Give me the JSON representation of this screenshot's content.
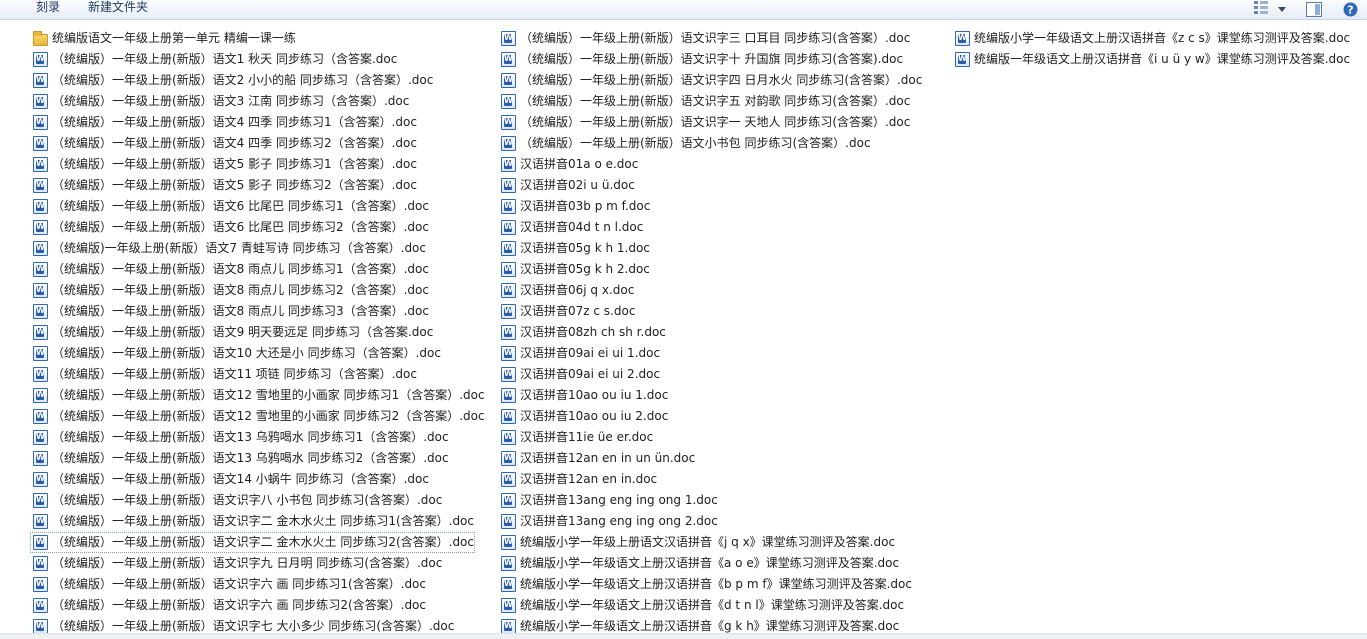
{
  "toolbar": {
    "burn_label": "刻录",
    "new_folder_label": "新建文件夹",
    "view_icon": "view-options-icon",
    "pane_icon": "preview-pane-icon",
    "help_icon": "help-icon"
  },
  "files": {
    "column1": [
      {
        "name": "统编版语文一年级上册第一单元 精编一课一练",
        "type": "folder"
      },
      {
        "name": "（统编版）一年级上册(新版）语文1 秋天 同步练习（含答案.doc",
        "type": "doc"
      },
      {
        "name": "（统编版）一年级上册(新版）语文2 小小的船 同步练习（含答案）.doc",
        "type": "doc"
      },
      {
        "name": "（统编版）一年级上册(新版）语文3 江南 同步练习（含答案）.doc",
        "type": "doc"
      },
      {
        "name": "（统编版）一年级上册(新版）语文4 四季 同步练习1（含答案）.doc",
        "type": "doc"
      },
      {
        "name": "（统编版）一年级上册(新版）语文4 四季 同步练习2（含答案）.doc",
        "type": "doc"
      },
      {
        "name": "（统编版）一年级上册(新版）语文5 影子 同步练习1（含答案）.doc",
        "type": "doc"
      },
      {
        "name": "（统编版）一年级上册(新版）语文5 影子 同步练习2（含答案）.doc",
        "type": "doc"
      },
      {
        "name": "（统编版）一年级上册(新版）语文6 比尾巴 同步练习1（含答案）.doc",
        "type": "doc"
      },
      {
        "name": "（统编版）一年级上册(新版）语文6 比尾巴 同步练习2（含答案）.doc",
        "type": "doc"
      },
      {
        "name": "（统编版)一年级上册(新版）语文7 青蛙写诗 同步练习（含答案）.doc",
        "type": "doc"
      },
      {
        "name": "（统编版）一年级上册(新版）语文8 雨点儿 同步练习1（含答案）.doc",
        "type": "doc"
      },
      {
        "name": "（统编版）一年级上册(新版）语文8 雨点儿 同步练习2（含答案）.doc",
        "type": "doc"
      },
      {
        "name": "（统编版）一年级上册(新版）语文8 雨点儿 同步练习3（含答案）.doc",
        "type": "doc"
      },
      {
        "name": "（统编版）一年级上册(新版）语文9 明天要远足 同步练习（含答案.doc",
        "type": "doc"
      },
      {
        "name": "（统编版）一年级上册(新版）语文10  大还是小 同步练习（含答案）.doc",
        "type": "doc"
      },
      {
        "name": "（统编版）一年级上册(新版）语文11 项链 同步练习（含答案）.doc",
        "type": "doc"
      },
      {
        "name": "（统编版）一年级上册(新版）语文12 雪地里的小画家 同步练习1（含答案）.doc",
        "type": "doc"
      },
      {
        "name": "（统编版）一年级上册(新版）语文12 雪地里的小画家 同步练习2（含答案）.doc",
        "type": "doc"
      },
      {
        "name": "（统编版）一年级上册(新版）语文13 乌鸦喝水 同步练习1（含答案）.doc",
        "type": "doc"
      },
      {
        "name": "（统编版）一年级上册(新版）语文13 乌鸦喝水 同步练习2（含答案）.doc",
        "type": "doc"
      },
      {
        "name": "（统编版）一年级上册(新版）语文14 小蜗牛 同步练习（含答案）.doc",
        "type": "doc"
      },
      {
        "name": "（统编版）一年级上册(新版）语文识字八 小书包 同步练习(含答案）.doc",
        "type": "doc"
      },
      {
        "name": "（统编版）一年级上册(新版）语文识字二 金木水火土 同步练习1(含答案）.doc",
        "type": "doc"
      },
      {
        "name": "（统编版）一年级上册(新版）语文识字二 金木水火土 同步练习2(含答案）.doc",
        "type": "doc"
      },
      {
        "name": "（统编版）一年级上册(新版）语文识字九 日月明 同步练习(含答案）.doc",
        "type": "doc"
      },
      {
        "name": "（统编版）一年级上册(新版）语文识字六 画 同步练习1(含答案）.doc",
        "type": "doc"
      },
      {
        "name": "（统编版）一年级上册(新版）语文识字六 画 同步练习2(含答案）.doc",
        "type": "doc"
      },
      {
        "name": "（统编版）一年级上册(新版）语文识字七 大小多少 同步练习(含答案）.doc",
        "type": "doc"
      }
    ],
    "column2": [
      {
        "name": "（统编版）一年级上册(新版）语文识字三 口耳目 同步练习(含答案）.doc",
        "type": "doc"
      },
      {
        "name": "（统编版）一年级上册(新版）语文识字十 升国旗  同步练习(含答案).doc",
        "type": "doc"
      },
      {
        "name": "（统编版）一年级上册(新版）语文识字四 日月水火 同步练习(含答案）.doc",
        "type": "doc"
      },
      {
        "name": "（统编版）一年级上册(新版）语文识字五 对韵歌 同步练习(含答案）.doc",
        "type": "doc"
      },
      {
        "name": "（统编版）一年级上册(新版）语文识字一 天地人 同步练习(含答案）.doc",
        "type": "doc"
      },
      {
        "name": "（统编版）一年级上册(新版）语文小书包 同步练习(含答案）.doc",
        "type": "doc"
      },
      {
        "name": "汉语拼音01a o e.doc",
        "type": "doc"
      },
      {
        "name": "汉语拼音02i u ü.doc",
        "type": "doc"
      },
      {
        "name": "汉语拼音03b p m f.doc",
        "type": "doc"
      },
      {
        "name": "汉语拼音04d t n l.doc",
        "type": "doc"
      },
      {
        "name": "汉语拼音05g k h  1.doc",
        "type": "doc"
      },
      {
        "name": "汉语拼音05g k h  2.doc",
        "type": "doc"
      },
      {
        "name": "汉语拼音06j q x.doc",
        "type": "doc"
      },
      {
        "name": "汉语拼音07z c s.doc",
        "type": "doc"
      },
      {
        "name": "汉语拼音08zh ch sh r.doc",
        "type": "doc"
      },
      {
        "name": "汉语拼音09ai ei ui  1.doc",
        "type": "doc"
      },
      {
        "name": "汉语拼音09ai ei ui  2.doc",
        "type": "doc"
      },
      {
        "name": "汉语拼音10ao ou iu  1.doc",
        "type": "doc"
      },
      {
        "name": "汉语拼音10ao ou iu  2.doc",
        "type": "doc"
      },
      {
        "name": "汉语拼音11ie üe er.doc",
        "type": "doc"
      },
      {
        "name": "汉语拼音12an en in un ün.doc",
        "type": "doc"
      },
      {
        "name": "汉语拼音12an en in.doc",
        "type": "doc"
      },
      {
        "name": "汉语拼音13ang eng ing ong  1.doc",
        "type": "doc"
      },
      {
        "name": "汉语拼音13ang eng ing ong  2.doc",
        "type": "doc"
      },
      {
        "name": "统编版小学一年级上册语文汉语拼音《j q x》课堂练习测评及答案.doc",
        "type": "doc"
      },
      {
        "name": "统编版小学一年级语文上册汉语拼音《a    o    e》课堂练习测评及答案.doc",
        "type": "doc"
      },
      {
        "name": "统编版小学一年级语文上册汉语拼音《b    p    m    f》课堂练习测评及答案.doc",
        "type": "doc"
      },
      {
        "name": "统编版小学一年级语文上册汉语拼音《d t n l》课堂练习测评及答案.doc",
        "type": "doc"
      },
      {
        "name": "统编版小学一年级语文上册汉语拼音《g k h》课堂练习测评及答案.doc",
        "type": "doc"
      }
    ],
    "column3": [
      {
        "name": "统编版小学一年级语文上册汉语拼音《z c s》课堂练习测评及答案.doc",
        "type": "doc"
      },
      {
        "name": "统编版一年级语文上册汉语拼音《i    u    ü    y    w》课堂练习测评及答案.doc",
        "type": "doc"
      }
    ]
  },
  "focused_item": "（统编版）一年级上册(新版）语文识字二 金木水火土 同步练习2(含答案）.doc"
}
